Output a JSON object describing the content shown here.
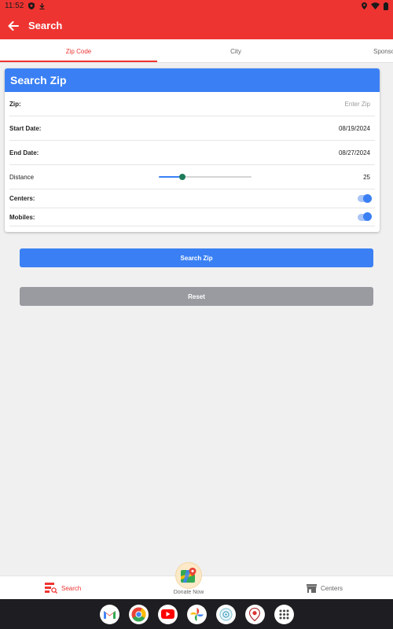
{
  "status_bar": {
    "time": "11:52"
  },
  "app_bar": {
    "title": "Search"
  },
  "tabs": [
    {
      "label": "Zip Code",
      "active": true
    },
    {
      "label": "City",
      "active": false
    },
    {
      "label": "Sponsor",
      "active": false
    }
  ],
  "card": {
    "title": "Search Zip",
    "zip": {
      "label": "Zip:",
      "placeholder": "Enter Zip"
    },
    "start_date": {
      "label": "Start Date:",
      "value": "08/19/2024"
    },
    "end_date": {
      "label": "End Date:",
      "value": "08/27/2024"
    },
    "distance": {
      "label": "Distance",
      "value": "25",
      "slider_fraction": 0.25
    },
    "centers": {
      "label": "Centers:",
      "on": true
    },
    "mobiles": {
      "label": "Mobiles:",
      "on": true
    }
  },
  "buttons": {
    "search": "Search Zip",
    "reset": "Reset"
  },
  "bottom_nav": {
    "search": "Search",
    "donate": "Donate Now",
    "centers": "Centers"
  },
  "colors": {
    "brand_red": "#ee3431",
    "accent_blue": "#3a80f4",
    "reset_gray": "#9a9ba0"
  },
  "dock_apps": [
    "gmail-icon",
    "chrome-icon",
    "youtube-icon",
    "photos-icon",
    "camera-icon",
    "maps-pin-icon",
    "app-drawer-icon"
  ]
}
